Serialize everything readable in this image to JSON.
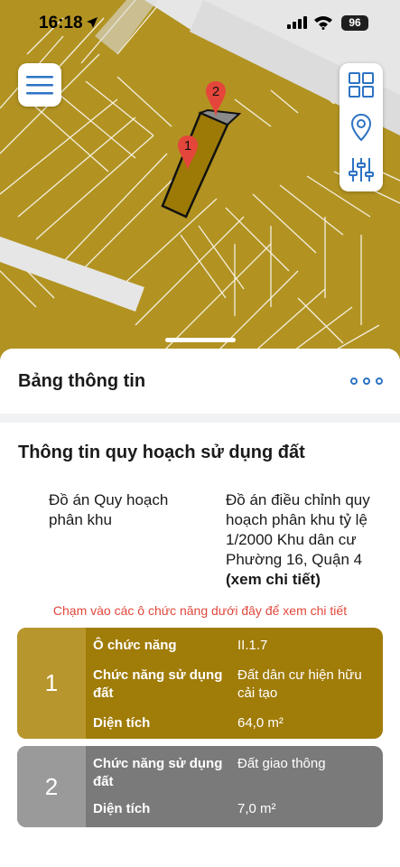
{
  "status_bar": {
    "time": "16:18",
    "battery": "96",
    "icons": [
      "location-arrow-icon",
      "cellular-signal-icon",
      "wifi-icon",
      "battery-icon"
    ]
  },
  "map": {
    "parcel_color": "#b29322",
    "road_color": "#e6e6e6",
    "markers": [
      {
        "label": "1",
        "color": "#e5463b"
      },
      {
        "label": "2",
        "color": "#e5463b"
      }
    ],
    "menu_icon": "hamburger-menu-icon",
    "tools": [
      "layers-grid-icon",
      "location-pin-icon",
      "filter-sliders-icon"
    ],
    "accent": "#2d73c4"
  },
  "panel": {
    "title": "Bảng thông tin",
    "more_icon": "more-dots-icon"
  },
  "land_use": {
    "section_title": "Thông tin quy hoạch sử dụng đất",
    "plan_label": "Đồ án Quy hoạch phân khu",
    "plan_value": "Đồ án điều chỉnh quy hoạch phân khu tỷ lệ 1/2000 Khu dân cư Phường 16, Quận 4",
    "plan_link": "(xem chi tiết)",
    "hint": "Chạm vào các ô chức năng dưới đây để xem chi tiết"
  },
  "cards": [
    {
      "number": "1",
      "color": "#a07c08",
      "rows": [
        {
          "label": "Ô chức năng",
          "value": "II.1.7"
        },
        {
          "label": "Chức năng sử dụng đất",
          "value": "Đất dân cư hiện hữu cải tạo"
        },
        {
          "label": "Diện tích",
          "value": "64,0 m²"
        }
      ]
    },
    {
      "number": "2",
      "color": "#7a7a7a",
      "rows": [
        {
          "label": "Chức năng sử dụng đất",
          "value": "Đất giao thông"
        },
        {
          "label": "Diện tích",
          "value": "7,0 m²"
        }
      ]
    }
  ]
}
